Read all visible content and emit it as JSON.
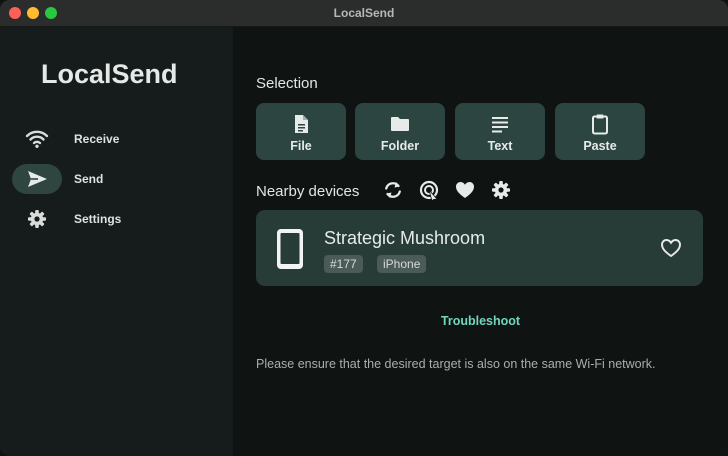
{
  "window": {
    "title": "LocalSend"
  },
  "sidebar": {
    "app_name": "LocalSend",
    "items": [
      {
        "label": "Receive",
        "icon": "wifi-icon",
        "active": false
      },
      {
        "label": "Send",
        "icon": "send-icon",
        "active": true
      },
      {
        "label": "Settings",
        "icon": "gear-icon",
        "active": false
      }
    ]
  },
  "selection": {
    "title": "Selection",
    "buttons": [
      {
        "label": "File",
        "icon": "file-icon"
      },
      {
        "label": "Folder",
        "icon": "folder-icon"
      },
      {
        "label": "Text",
        "icon": "text-icon"
      },
      {
        "label": "Paste",
        "icon": "clipboard-icon"
      }
    ]
  },
  "nearby": {
    "title": "Nearby devices",
    "tools": [
      "refresh-icon",
      "scan-icon",
      "heart-icon",
      "gear-icon"
    ],
    "devices": [
      {
        "name": "Strategic Mushroom",
        "id_tag": "#177",
        "type_tag": "iPhone",
        "icon": "phone-icon"
      }
    ]
  },
  "troubleshoot_label": "Troubleshoot",
  "hint": "Please ensure that the desired target is also on the same Wi-Fi network.",
  "colors": {
    "accent": "#6fd6c0",
    "button_bg": "#2d4540",
    "card_bg": "#283c37",
    "sidebar_bg": "#161c1b",
    "main_bg": "#0f1413"
  }
}
